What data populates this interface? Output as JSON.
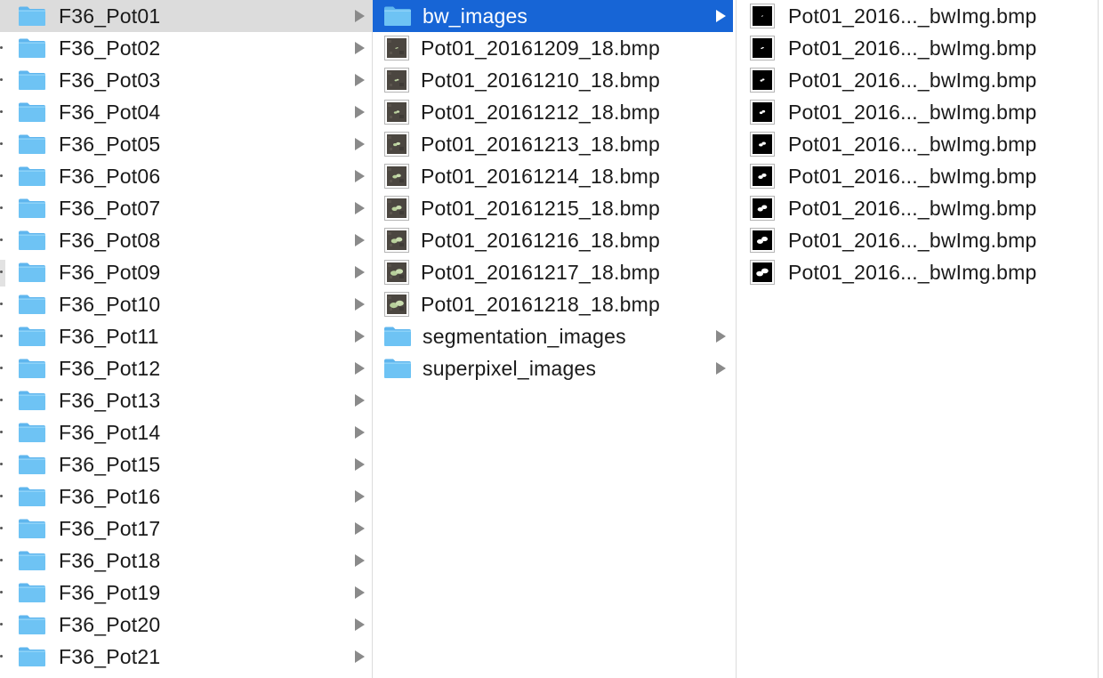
{
  "colors": {
    "selection_active": "#1765d6",
    "selection_inactive": "#dcdcdc",
    "folder_icon": "#6ec3f4",
    "chevron": "#8a8a8a",
    "text": "#1a1a1a"
  },
  "column1": {
    "selected_index": 0,
    "items": [
      {
        "label": "F36_Pot01",
        "icon": "folder-icon",
        "has_children": true
      },
      {
        "label": "F36_Pot02",
        "icon": "folder-icon",
        "has_children": true
      },
      {
        "label": "F36_Pot03",
        "icon": "folder-icon",
        "has_children": true
      },
      {
        "label": "F36_Pot04",
        "icon": "folder-icon",
        "has_children": true
      },
      {
        "label": "F36_Pot05",
        "icon": "folder-icon",
        "has_children": true
      },
      {
        "label": "F36_Pot06",
        "icon": "folder-icon",
        "has_children": true
      },
      {
        "label": "F36_Pot07",
        "icon": "folder-icon",
        "has_children": true
      },
      {
        "label": "F36_Pot08",
        "icon": "folder-icon",
        "has_children": true
      },
      {
        "label": "F36_Pot09",
        "icon": "folder-icon",
        "has_children": true
      },
      {
        "label": "F36_Pot10",
        "icon": "folder-icon",
        "has_children": true
      },
      {
        "label": "F36_Pot11",
        "icon": "folder-icon",
        "has_children": true
      },
      {
        "label": "F36_Pot12",
        "icon": "folder-icon",
        "has_children": true
      },
      {
        "label": "F36_Pot13",
        "icon": "folder-icon",
        "has_children": true
      },
      {
        "label": "F36_Pot14",
        "icon": "folder-icon",
        "has_children": true
      },
      {
        "label": "F36_Pot15",
        "icon": "folder-icon",
        "has_children": true
      },
      {
        "label": "F36_Pot16",
        "icon": "folder-icon",
        "has_children": true
      },
      {
        "label": "F36_Pot17",
        "icon": "folder-icon",
        "has_children": true
      },
      {
        "label": "F36_Pot18",
        "icon": "folder-icon",
        "has_children": true
      },
      {
        "label": "F36_Pot19",
        "icon": "folder-icon",
        "has_children": true
      },
      {
        "label": "F36_Pot20",
        "icon": "folder-icon",
        "has_children": true
      },
      {
        "label": "F36_Pot21",
        "icon": "folder-icon",
        "has_children": true
      }
    ]
  },
  "column2": {
    "selected_index": 0,
    "items": [
      {
        "label": "bw_images",
        "icon": "folder-icon",
        "has_children": true
      },
      {
        "label": "Pot01_20161209_18.bmp",
        "icon": "plant-photo-thumbnail-icon",
        "has_children": false
      },
      {
        "label": "Pot01_20161210_18.bmp",
        "icon": "plant-photo-thumbnail-icon",
        "has_children": false
      },
      {
        "label": "Pot01_20161212_18.bmp",
        "icon": "plant-photo-thumbnail-icon",
        "has_children": false
      },
      {
        "label": "Pot01_20161213_18.bmp",
        "icon": "plant-photo-thumbnail-icon",
        "has_children": false
      },
      {
        "label": "Pot01_20161214_18.bmp",
        "icon": "plant-photo-thumbnail-icon",
        "has_children": false
      },
      {
        "label": "Pot01_20161215_18.bmp",
        "icon": "plant-photo-thumbnail-icon",
        "has_children": false
      },
      {
        "label": "Pot01_20161216_18.bmp",
        "icon": "plant-photo-thumbnail-icon",
        "has_children": false
      },
      {
        "label": "Pot01_20161217_18.bmp",
        "icon": "plant-photo-thumbnail-icon",
        "has_children": false
      },
      {
        "label": "Pot01_20161218_18.bmp",
        "icon": "plant-photo-thumbnail-icon",
        "has_children": false
      },
      {
        "label": "segmentation_images",
        "icon": "folder-icon",
        "has_children": true
      },
      {
        "label": "superpixel_images",
        "icon": "folder-icon",
        "has_children": true
      }
    ]
  },
  "column3": {
    "selected_index": -1,
    "items": [
      {
        "label": "Pot01_2016..._bwImg.bmp",
        "icon": "bw-mask-thumbnail-icon",
        "has_children": false
      },
      {
        "label": "Pot01_2016..._bwImg.bmp",
        "icon": "bw-mask-thumbnail-icon",
        "has_children": false
      },
      {
        "label": "Pot01_2016..._bwImg.bmp",
        "icon": "bw-mask-thumbnail-icon",
        "has_children": false
      },
      {
        "label": "Pot01_2016..._bwImg.bmp",
        "icon": "bw-mask-thumbnail-icon",
        "has_children": false
      },
      {
        "label": "Pot01_2016..._bwImg.bmp",
        "icon": "bw-mask-thumbnail-icon",
        "has_children": false
      },
      {
        "label": "Pot01_2016..._bwImg.bmp",
        "icon": "bw-mask-thumbnail-icon",
        "has_children": false
      },
      {
        "label": "Pot01_2016..._bwImg.bmp",
        "icon": "bw-mask-thumbnail-icon",
        "has_children": false
      },
      {
        "label": "Pot01_2016..._bwImg.bmp",
        "icon": "bw-mask-thumbnail-icon",
        "has_children": false
      },
      {
        "label": "Pot01_2016..._bwImg.bmp",
        "icon": "bw-mask-thumbnail-icon",
        "has_children": false
      }
    ]
  }
}
